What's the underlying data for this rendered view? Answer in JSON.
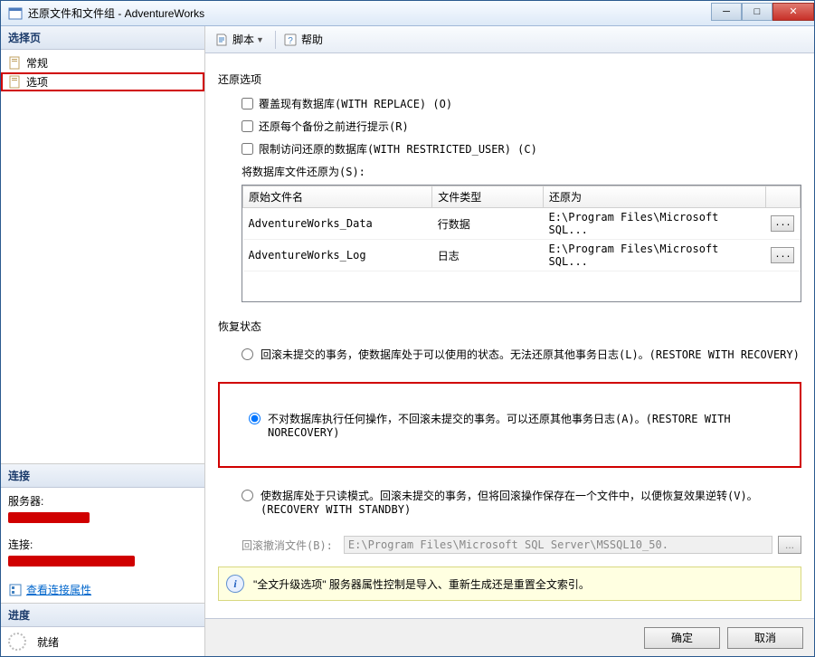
{
  "titlebar": {
    "text": "还原文件和文件组 - AdventureWorks"
  },
  "sidebar": {
    "select_page": "选择页",
    "items": [
      {
        "label": "常规"
      },
      {
        "label": "选项"
      }
    ],
    "connection_header": "连接",
    "server_label": "服务器:",
    "connection_label": "连接:",
    "view_conn_props": "查看连接属性",
    "progress_header": "进度",
    "ready_label": "就绪"
  },
  "toolbar": {
    "script": "脚本",
    "help": "帮助"
  },
  "restore_options": {
    "title": "还原选项",
    "chk_overwrite": "覆盖现有数据库(WITH REPLACE) (O)",
    "chk_prompt": "还原每个备份之前进行提示(R)",
    "chk_restrict": "限制访问还原的数据库(WITH RESTRICTED_USER) (C)",
    "restore_as_label": "将数据库文件还原为(S):",
    "table": {
      "headers": [
        "原始文件名",
        "文件类型",
        "还原为",
        ""
      ],
      "rows": [
        {
          "name": "AdventureWorks_Data",
          "type": "行数据",
          "path": "E:\\Program Files\\Microsoft SQL..."
        },
        {
          "name": "AdventureWorks_Log",
          "type": "日志",
          "path": "E:\\Program Files\\Microsoft SQL..."
        }
      ]
    },
    "browse": "..."
  },
  "recovery_state": {
    "title": "恢复状态",
    "radio_recovery": "回滚未提交的事务，使数据库处于可以使用的状态。无法还原其他事务日志(L)。(RESTORE WITH RECOVERY)",
    "radio_norecovery": "不对数据库执行任何操作，不回滚未提交的事务。可以还原其他事务日志(A)。(RESTORE WITH NORECOVERY)",
    "radio_standby": "使数据库处于只读模式。回滚未提交的事务，但将回滚操作保存在一个文件中，以便恢复效果逆转(V)。(RECOVERY WITH STANDBY)",
    "rollback_label": "回滚撤消文件(B):",
    "rollback_path": "E:\\Program Files\\Microsoft SQL Server\\MSSQL10_50."
  },
  "info_bar": "\"全文升级选项\" 服务器属性控制是导入、重新生成还是重置全文索引。",
  "buttons": {
    "ok": "确定",
    "cancel": "取消"
  }
}
